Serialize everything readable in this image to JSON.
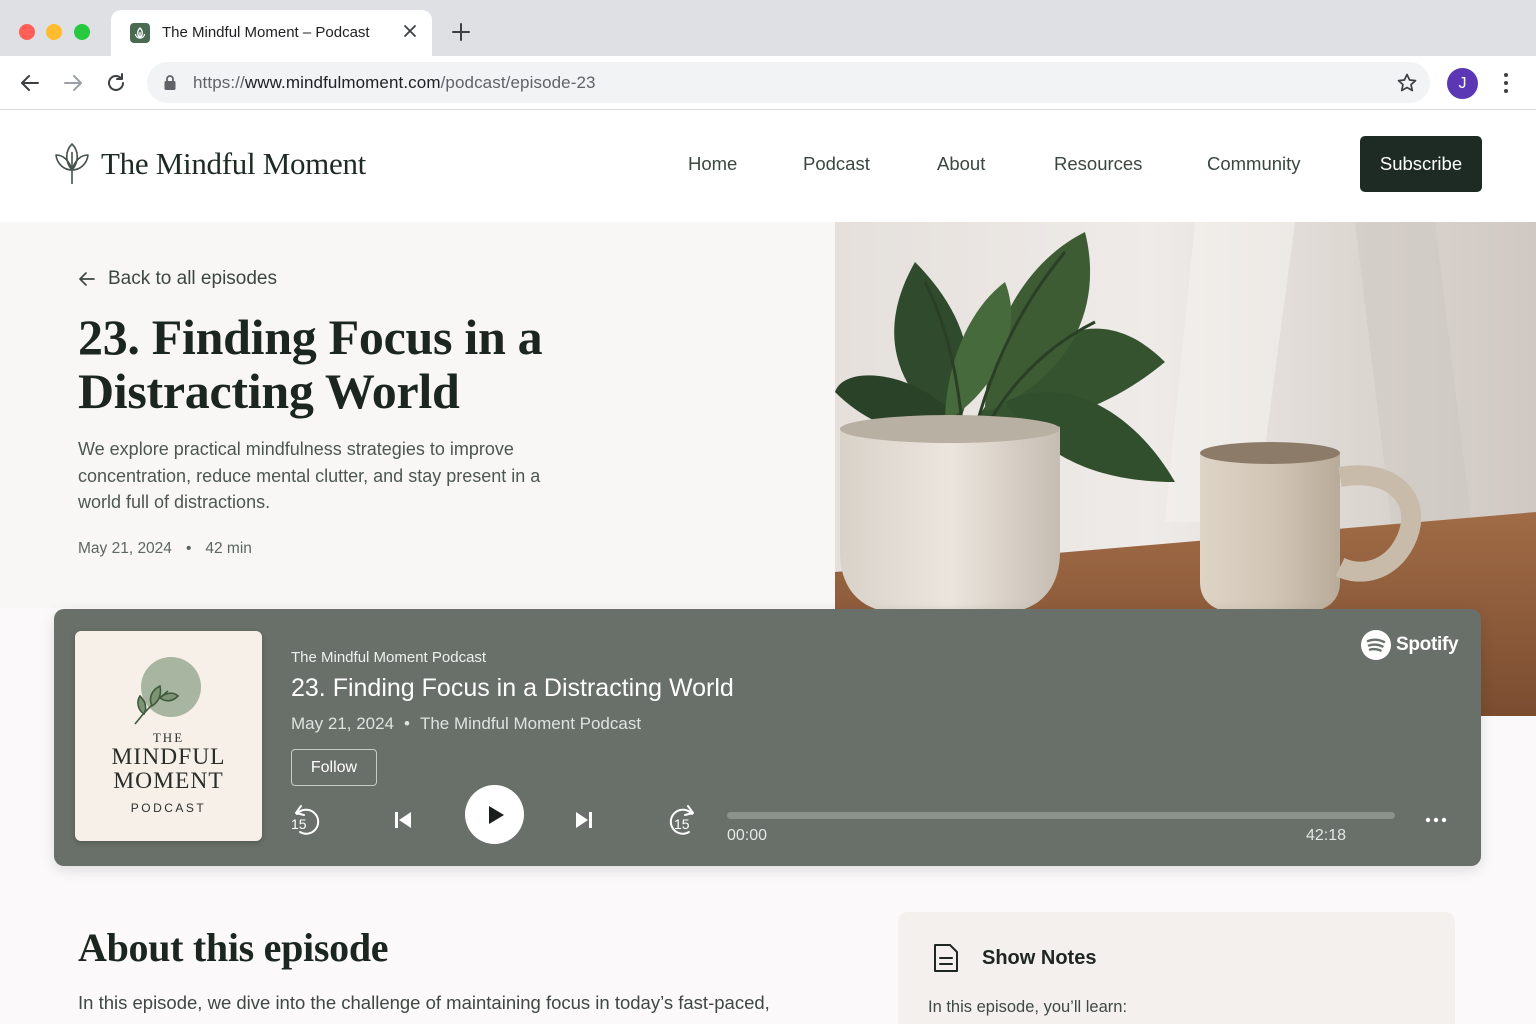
{
  "browser": {
    "tab_title": "The Mindful Moment – Podcast",
    "url_scheme": "https://",
    "url_host": "www.mindfulmoment.com",
    "url_path": "/podcast/episode-23",
    "profile_initial": "J"
  },
  "site": {
    "logo_text": "The Mindful Moment",
    "nav": [
      {
        "label": "Home"
      },
      {
        "label": "Podcast"
      },
      {
        "label": "About"
      },
      {
        "label": "Resources"
      },
      {
        "label": "Community"
      }
    ],
    "subscribe_label": "Subscribe"
  },
  "episode": {
    "back_label": "Back to all episodes",
    "title": "23. Finding Focus in a Distracting World",
    "description": "We explore practical mindfulness strategies to improve concentration, reduce mental clutter, and stay present in a world full of distractions.",
    "date": "May 21, 2024",
    "separator": "•",
    "duration": "42 min"
  },
  "player": {
    "cover_the": "THE",
    "cover_title_1": "MINDFUL",
    "cover_title_2": "MOMENT",
    "cover_subtitle": "PODCAST",
    "show_name": "The Mindful Moment Podcast",
    "title": "23. Finding Focus in a Distracting World",
    "date": "May 21, 2024",
    "separator": "•",
    "show_name_meta": "The Mindful Moment Podcast",
    "follow_label": "Follow",
    "brand": "Spotify",
    "rewind_seconds": "15",
    "forward_seconds": "15",
    "current_time": "00:00",
    "total_time": "42:18",
    "progress": 0.0
  },
  "about": {
    "heading": "About this episode",
    "body": "In this episode, we dive into the challenge of maintaining focus in today’s fast-paced,"
  },
  "show_notes": {
    "title": "Show Notes",
    "intro": "In this episode, you’ll learn:"
  },
  "colors": {
    "brand_dark": "#1e2b25",
    "player_bg": "#687069",
    "profile_avatar": "#5b37b5"
  }
}
